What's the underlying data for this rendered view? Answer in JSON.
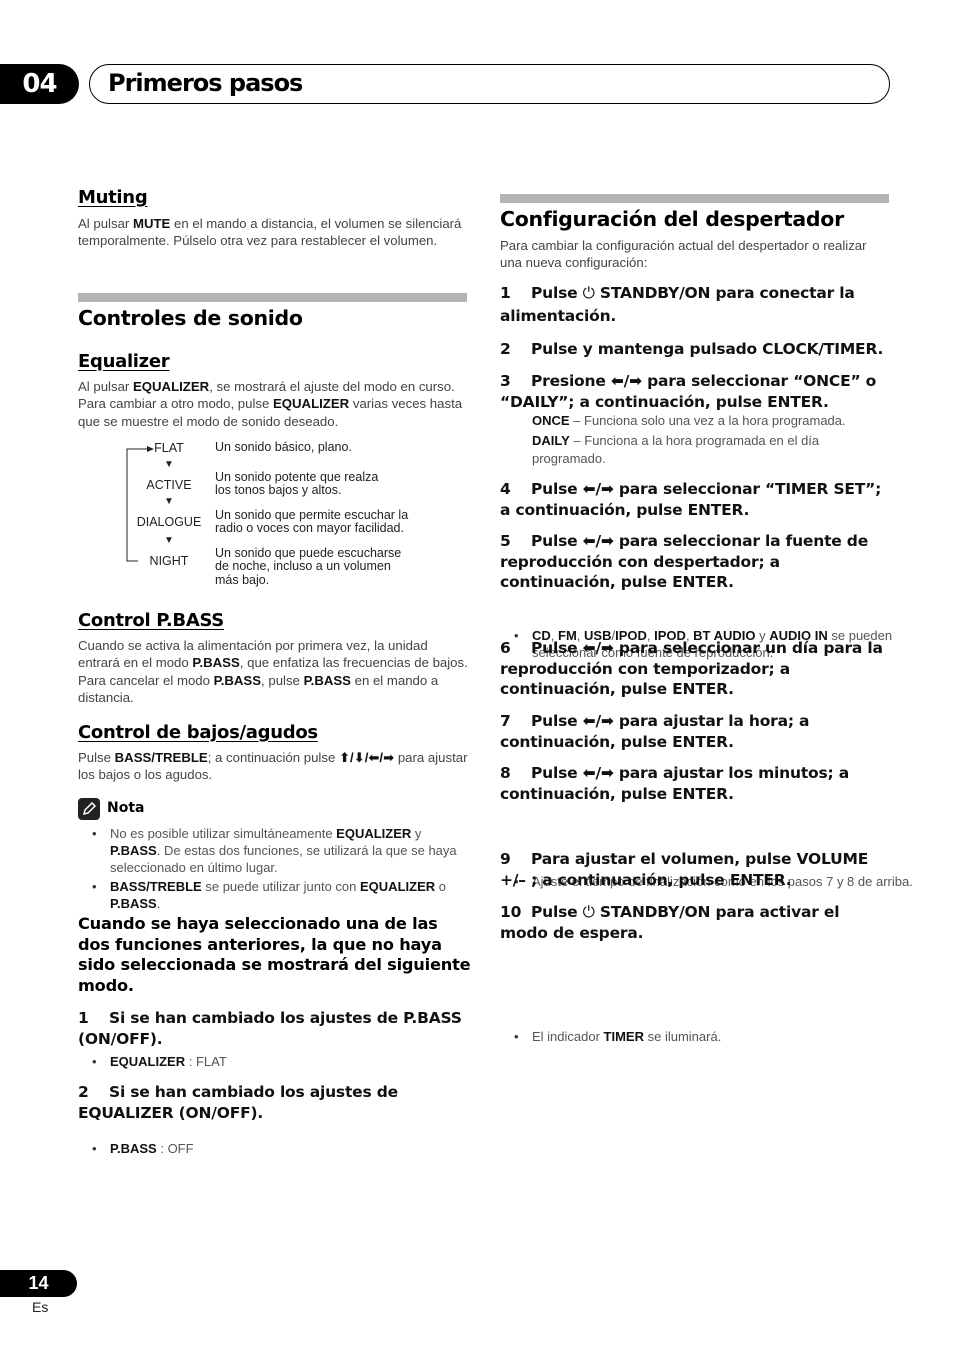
{
  "header": {
    "chapter_number": "04",
    "chapter_title": "Primeros pasos"
  },
  "left": {
    "muting": {
      "title": "Muting",
      "text_before": "Al pulsar ",
      "bold": "MUTE",
      "text_after": " en el mando a distancia, el volumen se silenciará temporalmente. Púlselo otra vez para restablecer el volumen."
    },
    "section_title": "Controles de sonido",
    "equalizer": {
      "title": "Equalizer",
      "p1": "Al pulsar ",
      "b1": "EQUALIZER",
      "p2": ", se mostrará el ajuste del modo en curso. Para cambiar a otro modo, pulse ",
      "b2": "EQUALIZER",
      "p3": " varias veces hasta que se muestre el modo de sonido deseado.",
      "modes": [
        {
          "name": "FLAT",
          "desc": "Un sonido básico, plano."
        },
        {
          "name": "ACTIVE",
          "desc": "Un sonido potente que realza los tonos bajos y altos."
        },
        {
          "name": "DIALOGUE",
          "desc": "Un sonido que permite escuchar la radio o voces con mayor facilidad."
        },
        {
          "name": "NIGHT",
          "desc": "Un sonido que puede escucharse de noche, incluso a un volumen más bajo."
        }
      ],
      "arrow_glyph": "🠗"
    },
    "pbass": {
      "title": "Control P.BASS",
      "p1": "Cuando se activa la alimentación por primera vez, la unidad entrará en el modo ",
      "b1": "P.BASS",
      "p2": ", que enfatiza las frecuencias de bajos. Para cancelar el modo ",
      "b2": "P.BASS",
      "p3": ", pulse ",
      "b3": "P.BASS",
      "p4": " en el mando a distancia."
    },
    "bass_treble": {
      "title": "Control de bajos/agudos",
      "p1": "Pulse ",
      "b1": "BASS/TREBLE",
      "p2": "; a continuación pulse ",
      "arrows": "⬆/⬇/⬅/➡",
      "p3": " para ajustar los bajos o los agudos."
    },
    "nota": {
      "title": "Nota",
      "icon": "pencil-icon",
      "bullets": [
        {
          "p1": "No es posible utilizar simultáneamente ",
          "b1": "EQUALIZER",
          "p2": " y ",
          "b2": "P.BASS",
          "p3": ". De estas dos funciones, se utilizará la que se haya seleccionado en último lugar."
        },
        {
          "b1": "BASS/TREBLE",
          "p1": " se puede utilizar junto con ",
          "b2": "EQUALIZER",
          "p2": " o ",
          "b3": "P.BASS",
          "p3": "."
        }
      ]
    },
    "bold_para": "Cuando se haya seleccionado una de las dos funciones anteriores, la que no haya sido seleccionada se mostrará del siguiente modo.",
    "steps": [
      {
        "num": "1",
        "text": "Si se han cambiado los ajustes de P.BASS (ON/OFF).",
        "bullet_bold": "EQUALIZER",
        "bullet_text": " : FLAT"
      },
      {
        "num": "2",
        "text": "Si se han cambiado los ajustes de EQUALIZER (ON/OFF).",
        "bullet_bold": "P.BASS",
        "bullet_text": " : OFF"
      }
    ]
  },
  "right": {
    "section_title": "Configuración del despertador",
    "intro": "Para cambiar la configuración actual del despertador o realizar una nueva configuración:",
    "power_glyph": "⏻",
    "lr_arrows": "⬅/➡",
    "steps": [
      {
        "num": "1",
        "pre": "Pulse ",
        "icon": "power",
        "post": " STANDBY/ON para conectar la alimentación."
      },
      {
        "num": "2",
        "pre": "Pulse y mantenga pulsado CLOCK/TIMER.",
        "icon": "",
        "post": ""
      },
      {
        "num": "3",
        "pre": "Presione ",
        "icon": "arrows",
        "post": " para seleccionar “ONCE” o “DAILY”; a continuación, pulse ENTER."
      },
      {
        "num": "4",
        "pre": "Pulse ",
        "icon": "arrows",
        "post": " para seleccionar “TIMER SET”; a continuación, pulse ENTER."
      },
      {
        "num": "5",
        "pre": "Pulse ",
        "icon": "arrows",
        "post": " para seleccionar la fuente de reproducción con despertador; a continuación, pulse ENTER."
      },
      {
        "num": "6",
        "pre": "Pulse ",
        "icon": "arrows",
        "post": " para seleccionar un día para la reproducción con temporizador; a continuación, pulse ENTER."
      },
      {
        "num": "7",
        "pre": "Pulse ",
        "icon": "arrows",
        "post": " para ajustar la hora; a continuación, pulse ENTER."
      },
      {
        "num": "8",
        "pre": "Pulse ",
        "icon": "arrows",
        "post": " para ajustar los minutos; a continuación, pulse ENTER."
      },
      {
        "num": "9",
        "pre": "Para ajustar el volumen, pulse VOLUME +/– ; a continuación, pulse ENTER.",
        "icon": "",
        "post": ""
      },
      {
        "num": "10",
        "pre": "Pulse ",
        "icon": "power",
        "post": " STANDBY/ON para activar el modo de espera."
      }
    ],
    "once": {
      "b": "ONCE",
      "t": " – Funciona solo una vez a la hora programada."
    },
    "daily": {
      "b": "DAILY",
      "t": " – Funciona a la hora programada en el día programado."
    },
    "sources_bullet": {
      "b1": "CD",
      "s1": ", ",
      "b2": "FM",
      "s2": ", ",
      "b3": "USB",
      "s3": "/",
      "b4": "IPOD",
      "s4": ", ",
      "b5": "IPOD",
      "s5": ", ",
      "b6": "BT AUDIO",
      "s6": " y ",
      "b7": "AUDIO IN",
      "t": " se pueden seleccionar como fuente de reproducción."
    },
    "end_time_bullet": "Ajuste el tiempo de finalización como en los pasos 7 y 8 de arriba.",
    "timer_bullet": {
      "p1": "El indicador ",
      "b": "TIMER",
      "p2": " se iluminará."
    }
  },
  "footer": {
    "page_number": "14",
    "language": "Es"
  }
}
